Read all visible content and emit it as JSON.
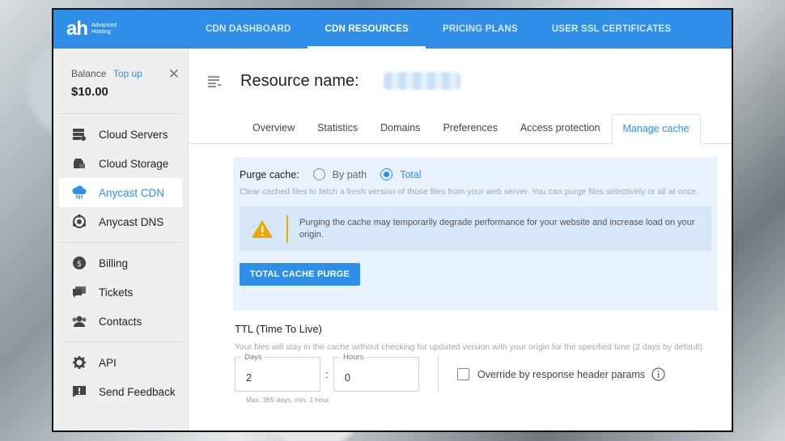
{
  "logo": {
    "mark": "ah",
    "line1": "Advanced",
    "line2": "Hosting"
  },
  "nav": [
    {
      "label": "CDN DASHBOARD"
    },
    {
      "label": "CDN RESOURCES"
    },
    {
      "label": "PRICING PLANS"
    },
    {
      "label": "USER SSL CERTIFICATES"
    }
  ],
  "balance": {
    "label": "Balance",
    "top_up": "Top up",
    "value": "$10.00",
    "close": "✕"
  },
  "sidebar": {
    "items": [
      {
        "label": "Cloud Servers",
        "icon": "server-icon"
      },
      {
        "label": "Cloud Storage",
        "icon": "storage-icon"
      },
      {
        "label": "Anycast CDN",
        "icon": "cloud-cdn-icon"
      },
      {
        "label": "Anycast DNS",
        "icon": "dns-icon"
      },
      {
        "label": "Billing",
        "icon": "billing-icon"
      },
      {
        "label": "Tickets",
        "icon": "tickets-icon"
      },
      {
        "label": "Contacts",
        "icon": "contacts-icon"
      },
      {
        "label": "API",
        "icon": "api-gear-icon"
      },
      {
        "label": "Send Feedback",
        "icon": "feedback-icon"
      }
    ]
  },
  "resource": {
    "label": "Resource name:"
  },
  "tabs": [
    {
      "label": "Overview"
    },
    {
      "label": "Statistics"
    },
    {
      "label": "Domains"
    },
    {
      "label": "Preferences"
    },
    {
      "label": "Access protection"
    },
    {
      "label": "Manage cache"
    }
  ],
  "purge": {
    "label": "Purge cache:",
    "option_path": "By path",
    "option_total": "Total",
    "selected": "Total",
    "description": "Clear cached files to fetch a fresh version of those files from your web server. You can purge files selectively or all at once.",
    "warning": "Purging the cache may temporarily degrade performance for your website and increase load on your origin.",
    "button": "TOTAL CACHE PURGE"
  },
  "ttl": {
    "title": "TTL (Time To Live)",
    "description": "Your files will stay in the cache without checking for updated version with your origin for the specified time (2 days by default)",
    "days_label": "Days",
    "days_value": "2",
    "separator": ":",
    "hours_label": "Hours",
    "hours_value": "0",
    "override_label": "Override by response header params",
    "hint": "Max. 365 days, min. 1 hour."
  },
  "colors": {
    "accent": "#2f8fe8",
    "warning": "#f0a500",
    "panel": "#e8f2fc"
  }
}
